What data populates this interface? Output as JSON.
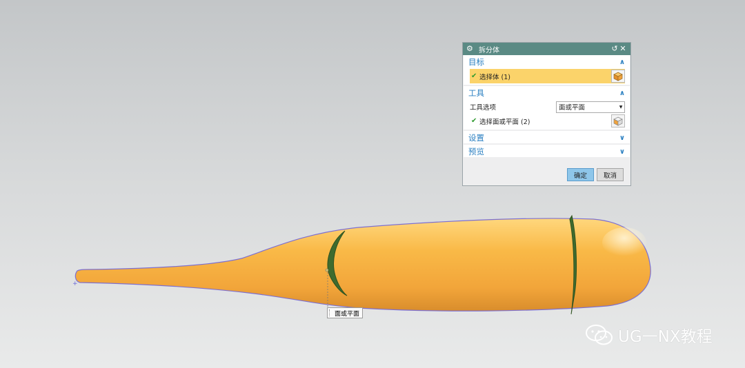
{
  "dialog": {
    "title": "拆分体",
    "target": {
      "header": "目标",
      "select_body_label": "选择体 (1)"
    },
    "tool": {
      "header": "工具",
      "tool_option_label": "工具选项",
      "tool_option_value": "面或平面",
      "select_face_label": "选择面或平面 (2)"
    },
    "settings_header": "设置",
    "preview_header": "预览",
    "ok_label": "确定",
    "cancel_label": "取消"
  },
  "viewport": {
    "tooltip": "面或平面"
  },
  "watermark": "UG一NX教程",
  "colors": {
    "title_bar": "#5a8a84",
    "active_selection": "#fbd36a",
    "section_header": "#2a7fc1",
    "body": "#f7b443",
    "split_plane": "#3f6b2e"
  }
}
